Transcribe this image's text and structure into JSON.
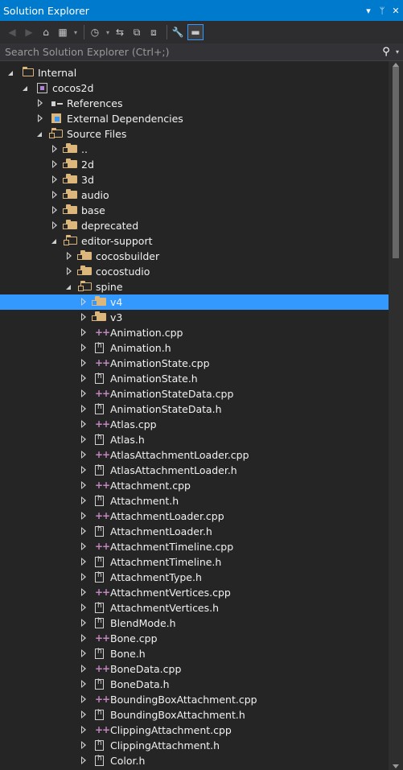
{
  "titlebar": {
    "title": "Solution Explorer",
    "dropdown": "▾",
    "pin": "ᛘ",
    "close": "✕"
  },
  "toolbar": {
    "back": "◀",
    "forward": "▶",
    "home": "⌂",
    "switch_views": "▦",
    "dropdown": "▾",
    "pending_changes": "◷",
    "sync": "⇆",
    "collapse_all": "⧉",
    "show_all": "⧈",
    "properties": "🔧",
    "preview": "▬"
  },
  "search": {
    "placeholder": "Search Solution Explorer (Ctrl+;)",
    "icon": "⚲",
    "dropdown": "▾"
  },
  "colors": {
    "accent": "#007acc",
    "selection": "#3399ff",
    "folder": "#dcb67a",
    "cpp": "#c586c0",
    "background": "#252526"
  },
  "tree": [
    {
      "label": "Internal",
      "depth": 0,
      "icon": "folder-open-icon",
      "expander": "expanded"
    },
    {
      "label": "cocos2d",
      "depth": 1,
      "icon": "project-icon",
      "expander": "expanded"
    },
    {
      "label": "References",
      "depth": 2,
      "icon": "references-icon",
      "expander": "collapsed"
    },
    {
      "label": "External Dependencies",
      "depth": 2,
      "icon": "external-dependencies-icon",
      "expander": "collapsed"
    },
    {
      "label": "Source Files",
      "depth": 2,
      "icon": "filter-folder-open-icon",
      "expander": "expanded"
    },
    {
      "label": "..",
      "depth": 3,
      "icon": "filter-folder-icon",
      "expander": "collapsed"
    },
    {
      "label": "2d",
      "depth": 3,
      "icon": "filter-folder-icon",
      "expander": "collapsed"
    },
    {
      "label": "3d",
      "depth": 3,
      "icon": "filter-folder-icon",
      "expander": "collapsed"
    },
    {
      "label": "audio",
      "depth": 3,
      "icon": "filter-folder-icon",
      "expander": "collapsed"
    },
    {
      "label": "base",
      "depth": 3,
      "icon": "filter-folder-icon",
      "expander": "collapsed"
    },
    {
      "label": "deprecated",
      "depth": 3,
      "icon": "filter-folder-icon",
      "expander": "collapsed"
    },
    {
      "label": "editor-support",
      "depth": 3,
      "icon": "filter-folder-open-icon",
      "expander": "expanded"
    },
    {
      "label": "cocosbuilder",
      "depth": 4,
      "icon": "filter-folder-icon",
      "expander": "collapsed"
    },
    {
      "label": "cocostudio",
      "depth": 4,
      "icon": "filter-folder-icon",
      "expander": "collapsed"
    },
    {
      "label": "spine",
      "depth": 4,
      "icon": "filter-folder-open-icon",
      "expander": "expanded"
    },
    {
      "label": "v4",
      "depth": 5,
      "icon": "filter-folder-icon",
      "expander": "collapsed",
      "selected": true
    },
    {
      "label": "v3",
      "depth": 5,
      "icon": "filter-folder-icon",
      "expander": "collapsed"
    },
    {
      "label": "Animation.cpp",
      "depth": 5,
      "icon": "cpp-file-icon",
      "expander": "collapsed"
    },
    {
      "label": "Animation.h",
      "depth": 5,
      "icon": "header-file-icon",
      "expander": "collapsed"
    },
    {
      "label": "AnimationState.cpp",
      "depth": 5,
      "icon": "cpp-file-icon",
      "expander": "collapsed"
    },
    {
      "label": "AnimationState.h",
      "depth": 5,
      "icon": "header-file-icon",
      "expander": "collapsed"
    },
    {
      "label": "AnimationStateData.cpp",
      "depth": 5,
      "icon": "cpp-file-icon",
      "expander": "collapsed"
    },
    {
      "label": "AnimationStateData.h",
      "depth": 5,
      "icon": "header-file-icon",
      "expander": "collapsed"
    },
    {
      "label": "Atlas.cpp",
      "depth": 5,
      "icon": "cpp-file-icon",
      "expander": "collapsed"
    },
    {
      "label": "Atlas.h",
      "depth": 5,
      "icon": "header-file-icon",
      "expander": "collapsed"
    },
    {
      "label": "AtlasAttachmentLoader.cpp",
      "depth": 5,
      "icon": "cpp-file-icon",
      "expander": "collapsed"
    },
    {
      "label": "AtlasAttachmentLoader.h",
      "depth": 5,
      "icon": "header-file-icon",
      "expander": "collapsed"
    },
    {
      "label": "Attachment.cpp",
      "depth": 5,
      "icon": "cpp-file-icon",
      "expander": "collapsed"
    },
    {
      "label": "Attachment.h",
      "depth": 5,
      "icon": "header-file-icon",
      "expander": "collapsed"
    },
    {
      "label": "AttachmentLoader.cpp",
      "depth": 5,
      "icon": "cpp-file-icon",
      "expander": "collapsed"
    },
    {
      "label": "AttachmentLoader.h",
      "depth": 5,
      "icon": "header-file-icon",
      "expander": "collapsed"
    },
    {
      "label": "AttachmentTimeline.cpp",
      "depth": 5,
      "icon": "cpp-file-icon",
      "expander": "collapsed"
    },
    {
      "label": "AttachmentTimeline.h",
      "depth": 5,
      "icon": "header-file-icon",
      "expander": "collapsed"
    },
    {
      "label": "AttachmentType.h",
      "depth": 5,
      "icon": "header-file-icon",
      "expander": "collapsed"
    },
    {
      "label": "AttachmentVertices.cpp",
      "depth": 5,
      "icon": "cpp-file-icon",
      "expander": "collapsed"
    },
    {
      "label": "AttachmentVertices.h",
      "depth": 5,
      "icon": "header-file-icon",
      "expander": "collapsed"
    },
    {
      "label": "BlendMode.h",
      "depth": 5,
      "icon": "header-file-icon",
      "expander": "collapsed"
    },
    {
      "label": "Bone.cpp",
      "depth": 5,
      "icon": "cpp-file-icon",
      "expander": "collapsed"
    },
    {
      "label": "Bone.h",
      "depth": 5,
      "icon": "header-file-icon",
      "expander": "collapsed"
    },
    {
      "label": "BoneData.cpp",
      "depth": 5,
      "icon": "cpp-file-icon",
      "expander": "collapsed"
    },
    {
      "label": "BoneData.h",
      "depth": 5,
      "icon": "header-file-icon",
      "expander": "collapsed"
    },
    {
      "label": "BoundingBoxAttachment.cpp",
      "depth": 5,
      "icon": "cpp-file-icon",
      "expander": "collapsed"
    },
    {
      "label": "BoundingBoxAttachment.h",
      "depth": 5,
      "icon": "header-file-icon",
      "expander": "collapsed"
    },
    {
      "label": "ClippingAttachment.cpp",
      "depth": 5,
      "icon": "cpp-file-icon",
      "expander": "collapsed"
    },
    {
      "label": "ClippingAttachment.h",
      "depth": 5,
      "icon": "header-file-icon",
      "expander": "collapsed"
    },
    {
      "label": "Color.h",
      "depth": 5,
      "icon": "header-file-icon",
      "expander": "collapsed"
    }
  ]
}
